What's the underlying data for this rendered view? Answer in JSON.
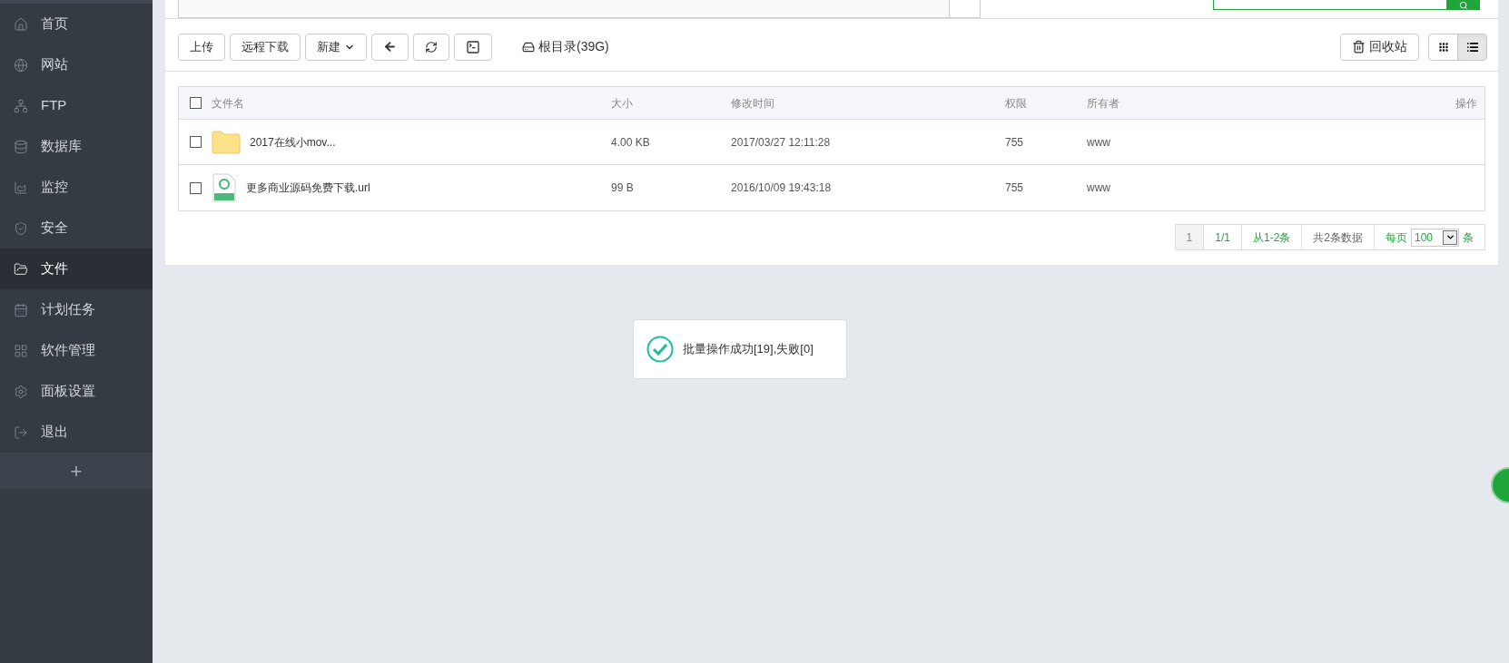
{
  "sidebar": {
    "items": [
      {
        "label": "首页",
        "selected": false
      },
      {
        "label": "网站",
        "selected": false
      },
      {
        "label": "FTP",
        "selected": false
      },
      {
        "label": "数据库",
        "selected": false
      },
      {
        "label": "监控",
        "selected": false
      },
      {
        "label": "安全",
        "selected": false
      },
      {
        "label": "文件",
        "selected": true
      },
      {
        "label": "计划任务",
        "selected": false
      },
      {
        "label": "软件管理",
        "selected": false
      },
      {
        "label": "面板设置",
        "selected": false
      },
      {
        "label": "退出",
        "selected": false
      }
    ],
    "add_button": "+"
  },
  "toolbar": {
    "buttons": [
      {
        "kind": "text",
        "label": "上传"
      },
      {
        "kind": "text",
        "label": "远程下载"
      },
      {
        "kind": "dropdown",
        "label": "新建"
      },
      {
        "kind": "back"
      },
      {
        "kind": "refresh"
      },
      {
        "kind": "terminal"
      }
    ],
    "disk": "根目录(39G)",
    "recycle": "回收站",
    "views": [
      {
        "kind": "grid",
        "selected": false
      },
      {
        "kind": "list",
        "selected": true
      }
    ]
  },
  "table": {
    "select_all_checked": false,
    "columns": [
      "文件名",
      "大小",
      "修改时间",
      "权限",
      "所有者",
      "操作"
    ],
    "rows": [
      {
        "kind": "folder",
        "checked": false,
        "name": "2017在线小mov...",
        "size": "4.00 KB",
        "modified": "2017/03/27 12:11:28",
        "permission": "755",
        "owner": "www"
      },
      {
        "kind": "url",
        "checked": false,
        "name": "更多商业源码免费下载.url",
        "size": "99 B",
        "modified": "2016/10/09 19:43:18",
        "permission": "755",
        "owner": "www"
      }
    ]
  },
  "pagination": {
    "current": "1",
    "pages": "1/1",
    "range": "从1-2条",
    "total": "共2条数据",
    "per_page_label": "每页",
    "per_page": "100",
    "per_page_suffix": "条"
  },
  "toast": {
    "message": "批量操作成功[19],失败[0]"
  }
}
